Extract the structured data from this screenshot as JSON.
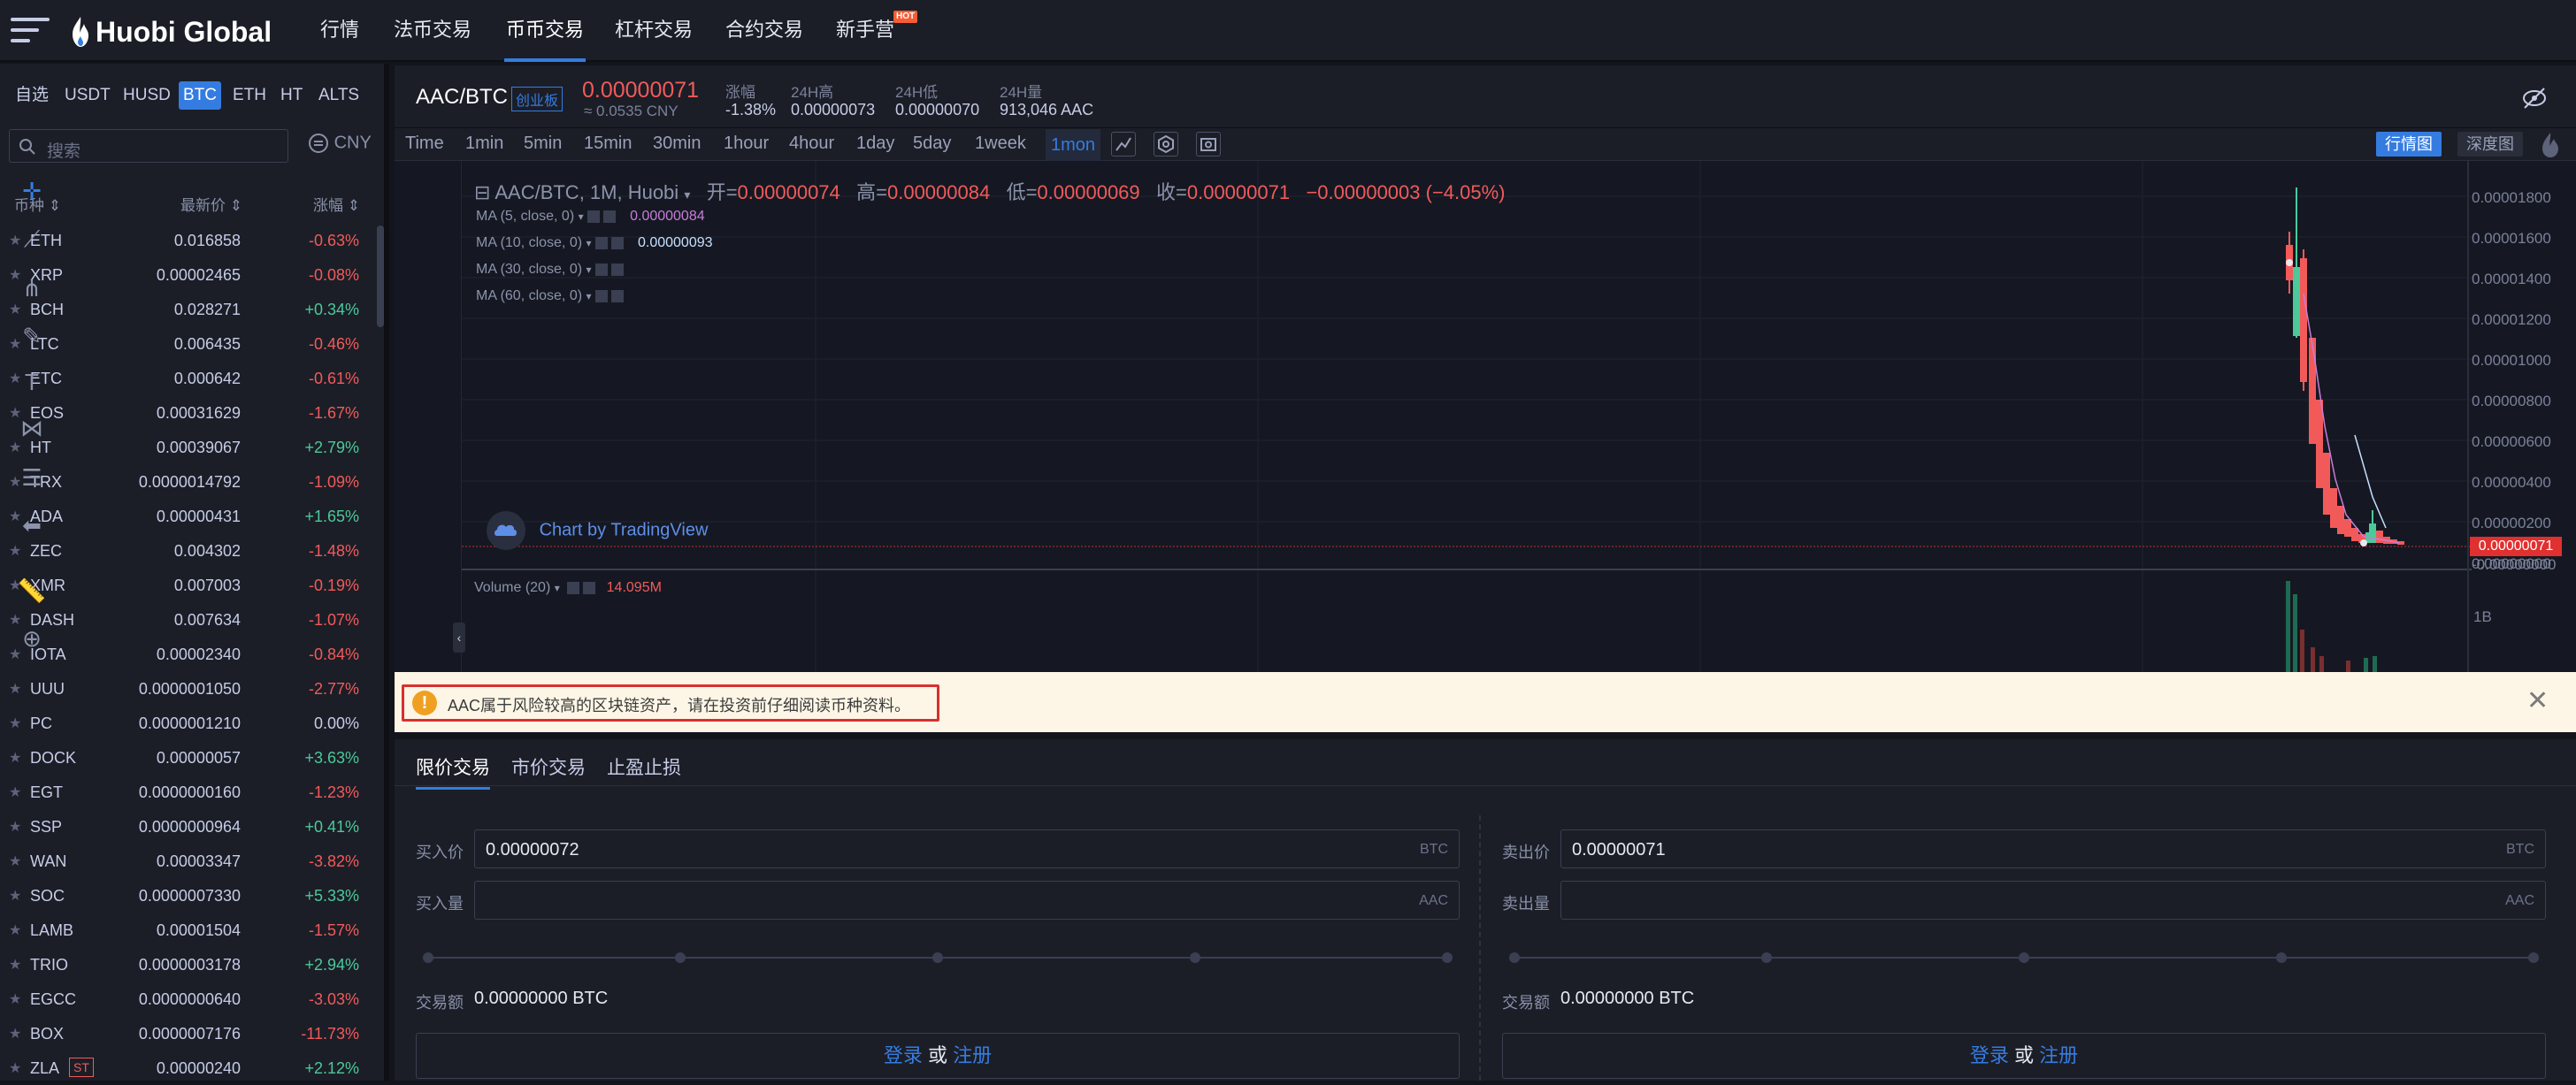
{
  "nav": {
    "logo": "Huobi Global",
    "items": [
      "行情",
      "法币交易",
      "币币交易",
      "杠杆交易",
      "合约交易",
      "新手营"
    ],
    "active_index": 2,
    "hot_badge": "HOT"
  },
  "sidebar": {
    "quote_tabs": [
      "自选",
      "USDT",
      "HUSD",
      "BTC",
      "ETH",
      "HT",
      "ALTS"
    ],
    "active_tab": "BTC",
    "search_placeholder": "搜索",
    "currency": "CNY",
    "columns": {
      "symbol": "币种",
      "price": "最新价",
      "change": "涨幅"
    },
    "rows": [
      {
        "sym": "ETH",
        "price": "0.016858",
        "change": "-0.63%",
        "dir": "dn"
      },
      {
        "sym": "XRP",
        "price": "0.00002465",
        "change": "-0.08%",
        "dir": "dn"
      },
      {
        "sym": "BCH",
        "price": "0.028271",
        "change": "+0.34%",
        "dir": "up"
      },
      {
        "sym": "LTC",
        "price": "0.006435",
        "change": "-0.46%",
        "dir": "dn"
      },
      {
        "sym": "ETC",
        "price": "0.000642",
        "change": "-0.61%",
        "dir": "dn"
      },
      {
        "sym": "EOS",
        "price": "0.00031629",
        "change": "-1.67%",
        "dir": "dn"
      },
      {
        "sym": "HT",
        "price": "0.00039067",
        "change": "+2.79%",
        "dir": "up"
      },
      {
        "sym": "TRX",
        "price": "0.0000014792",
        "change": "-1.09%",
        "dir": "dn"
      },
      {
        "sym": "ADA",
        "price": "0.00000431",
        "change": "+1.65%",
        "dir": "up"
      },
      {
        "sym": "ZEC",
        "price": "0.004302",
        "change": "-1.48%",
        "dir": "dn"
      },
      {
        "sym": "XMR",
        "price": "0.007003",
        "change": "-0.19%",
        "dir": "dn"
      },
      {
        "sym": "DASH",
        "price": "0.007634",
        "change": "-1.07%",
        "dir": "dn"
      },
      {
        "sym": "IOTA",
        "price": "0.00002340",
        "change": "-0.84%",
        "dir": "dn"
      },
      {
        "sym": "UUU",
        "price": "0.0000001050",
        "change": "-2.77%",
        "dir": "dn"
      },
      {
        "sym": "PC",
        "price": "0.0000001210",
        "change": "0.00%",
        "dir": "zero"
      },
      {
        "sym": "DOCK",
        "price": "0.00000057",
        "change": "+3.63%",
        "dir": "up"
      },
      {
        "sym": "EGT",
        "price": "0.0000000160",
        "change": "-1.23%",
        "dir": "dn"
      },
      {
        "sym": "SSP",
        "price": "0.0000000964",
        "change": "+0.41%",
        "dir": "up"
      },
      {
        "sym": "WAN",
        "price": "0.00003347",
        "change": "-3.82%",
        "dir": "dn"
      },
      {
        "sym": "SOC",
        "price": "0.0000007330",
        "change": "+5.33%",
        "dir": "up"
      },
      {
        "sym": "LAMB",
        "price": "0.00001504",
        "change": "-1.57%",
        "dir": "dn"
      },
      {
        "sym": "TRIO",
        "price": "0.0000003178",
        "change": "+2.94%",
        "dir": "up"
      },
      {
        "sym": "EGCC",
        "price": "0.0000000640",
        "change": "-3.03%",
        "dir": "dn"
      },
      {
        "sym": "BOX",
        "price": "0.0000007176",
        "change": "-11.73%",
        "dir": "dn"
      },
      {
        "sym": "ZLA",
        "price": "0.00000240",
        "change": "+2.12%",
        "dir": "up",
        "tag": "ST"
      }
    ]
  },
  "pair": {
    "name": "AAC/BTC",
    "board": "创业板",
    "price": "0.00000071",
    "cny": "≈ 0.0535 CNY",
    "change_label": "涨幅",
    "change": "-1.38%",
    "high_label": "24H高",
    "high": "0.00000073",
    "low_label": "24H低",
    "low": "0.00000070",
    "vol_label": "24H量",
    "vol": "913,046 AAC"
  },
  "intervals": [
    "Time",
    "1min",
    "5min",
    "15min",
    "30min",
    "1hour",
    "4hour",
    "1day",
    "5day",
    "1week",
    "1mon"
  ],
  "active_interval": "1mon",
  "chart_tabs": {
    "kline": "行情图",
    "depth": "深度图"
  },
  "chart": {
    "legend_title": "AAC/BTC, 1M, Huobi",
    "open_label": "开=",
    "open": "0.00000074",
    "high_label": "高=",
    "high": "0.00000084",
    "low_label": "低=",
    "low": "0.00000069",
    "close_label": "收=",
    "close": "0.00000071",
    "delta": "−0.00000003 (−4.05%)",
    "ma": [
      {
        "label": "MA (5, close, 0)",
        "value": "0.00000084",
        "color": "#c77dd8"
      },
      {
        "label": "MA (10, close, 0)",
        "value": "0.00000093",
        "color": "#c7e0ff"
      },
      {
        "label": "MA (30, close, 0)",
        "value": "",
        "color": "#8c93ab"
      },
      {
        "label": "MA (60, close, 0)",
        "value": "",
        "color": "#8c93ab"
      }
    ],
    "watermark": "Chart by TradingView",
    "y_ticks": [
      "0.00001800",
      "0.00001600",
      "0.00001400",
      "0.00001200",
      "0.00001000",
      "0.00000800",
      "0.00000600",
      "0.00000400",
      "0.00000200",
      "0.00000000",
      "-0.00000000"
    ],
    "last_price_tag": "0.00000071",
    "volume_label": "Volume (20)",
    "volume_value": "14.095M",
    "volume_tick": "1B"
  },
  "warning": {
    "text": "AAC属于风险较高的区块链资产，请在投资前仔细阅读币种资料。",
    "close": "✕"
  },
  "trade": {
    "tabs": [
      "限价交易",
      "市价交易",
      "止盈止损"
    ],
    "buy": {
      "price_label": "买入价",
      "price": "0.00000072",
      "price_unit": "BTC",
      "amount_label": "买入量",
      "amount_unit": "AAC",
      "total_label": "交易额",
      "total": "0.00000000 BTC"
    },
    "sell": {
      "price_label": "卖出价",
      "price": "0.00000071",
      "price_unit": "BTC",
      "amount_label": "卖出量",
      "amount_unit": "AAC",
      "total_label": "交易额",
      "total": "0.00000000 BTC"
    },
    "login": "登录",
    "or": "或",
    "register": "注册"
  }
}
